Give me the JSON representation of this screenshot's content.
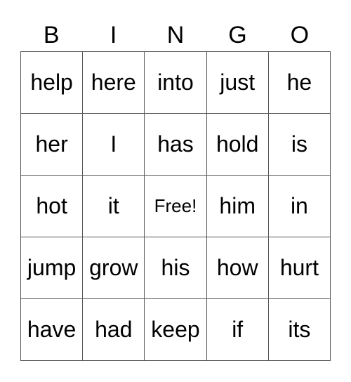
{
  "header": [
    "B",
    "I",
    "N",
    "G",
    "O"
  ],
  "cells": [
    [
      "help",
      "here",
      "into",
      "just",
      "he"
    ],
    [
      "her",
      "I",
      "has",
      "hold",
      "is"
    ],
    [
      "hot",
      "it",
      "Free!",
      "him",
      "in"
    ],
    [
      "jump",
      "grow",
      "his",
      "how",
      "hurt"
    ],
    [
      "have",
      "had",
      "keep",
      "if",
      "its"
    ]
  ],
  "free_cell": {
    "row": 2,
    "col": 2
  }
}
